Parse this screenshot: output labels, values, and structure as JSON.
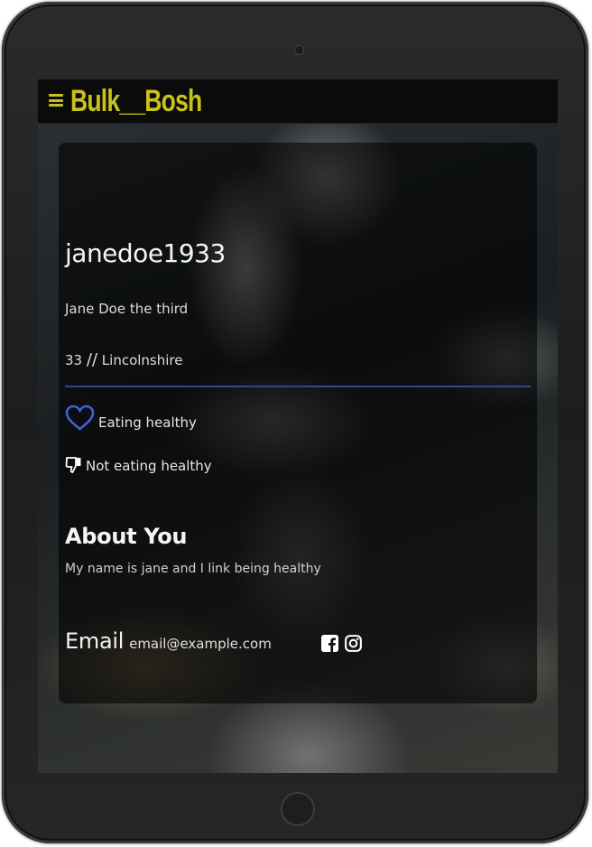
{
  "app": {
    "brand": "Bulk__Bosh"
  },
  "profile": {
    "username": "janedoe1933",
    "full_name": "Jane Doe the third",
    "age": "33",
    "separator": "//",
    "location": "Lincolnshire"
  },
  "preferences": {
    "likes_label": "Eating healthy",
    "dislikes_label": "Not eating healthy"
  },
  "about": {
    "title": "About You",
    "text": "My name is jane and I link being healthy"
  },
  "contact": {
    "email_label": "Email",
    "email_value": "email@example.com"
  },
  "icons": {
    "menu": "hamburger-menu-icon",
    "like": "heart-icon",
    "dislike": "thumbs-down-icon",
    "facebook": "facebook-icon",
    "instagram": "instagram-icon"
  },
  "colors": {
    "brand": "#c8c21a",
    "accent": "#3d63d8",
    "divider": "#2f4a8c"
  }
}
